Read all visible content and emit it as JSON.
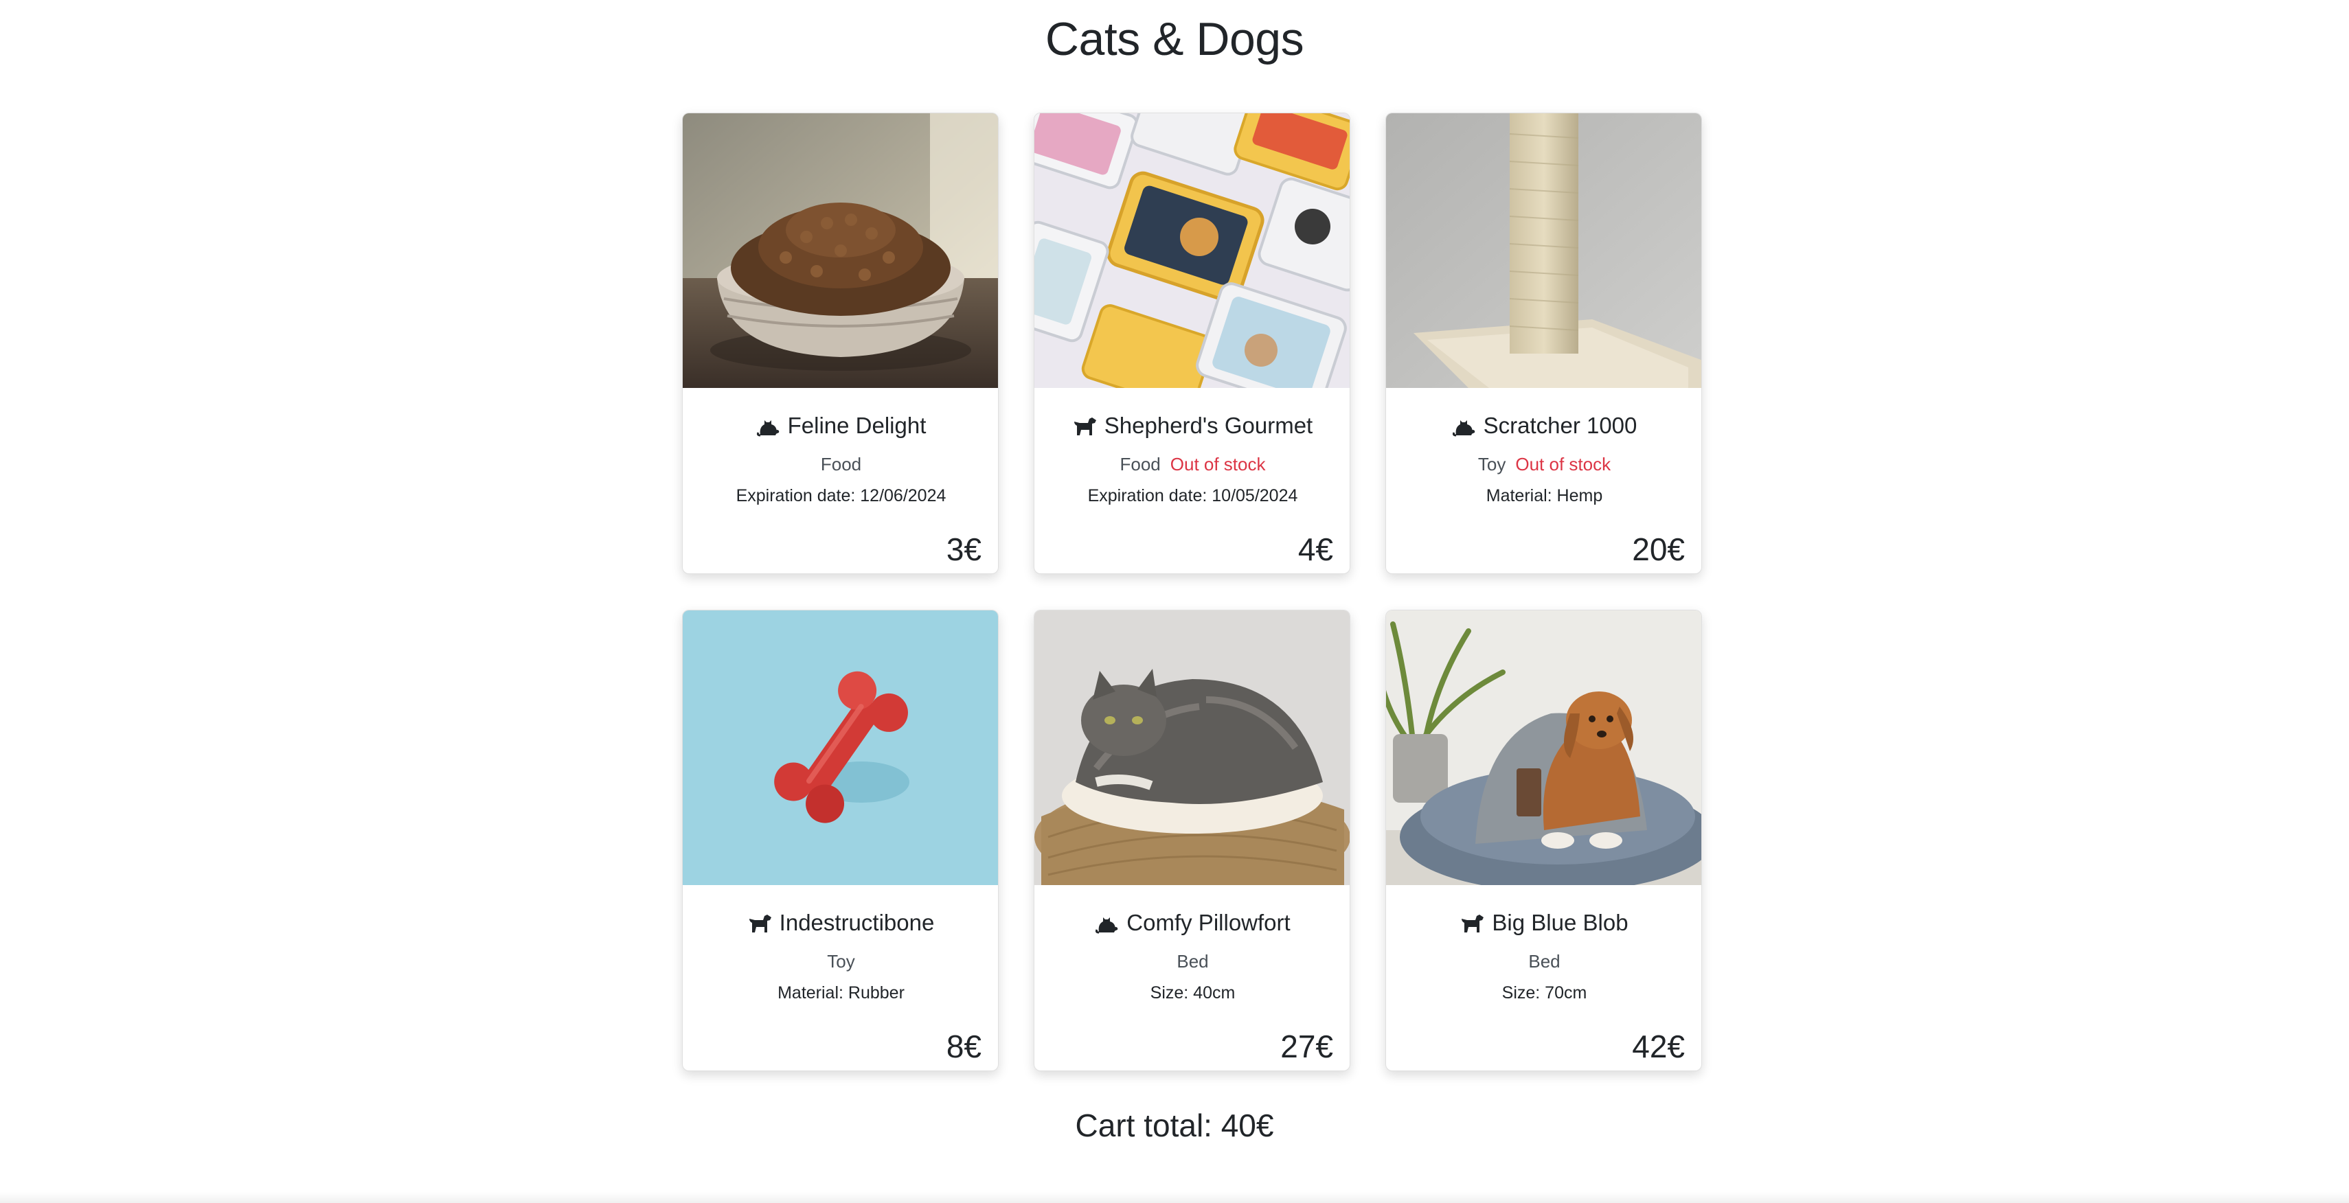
{
  "page": {
    "title": "Cats & Dogs"
  },
  "products": [
    {
      "name": "Feline Delight",
      "pet_icon": "cat-icon",
      "category": "Food",
      "stock_status": "",
      "detail": "Expiration date: 12/06/2024",
      "price": "3€",
      "image": "kibble-bowl-image"
    },
    {
      "name": "Shepherd's Gourmet",
      "pet_icon": "dog-icon",
      "category": "Food",
      "stock_status": "Out of stock",
      "detail": "Expiration date: 10/05/2024",
      "price": "4€",
      "image": "food-trays-image"
    },
    {
      "name": "Scratcher 1000",
      "pet_icon": "cat-icon",
      "category": "Toy",
      "stock_status": "Out of stock",
      "detail": "Material: Hemp",
      "price": "20€",
      "image": "scratching-post-image"
    },
    {
      "name": "Indestructibone",
      "pet_icon": "dog-icon",
      "category": "Toy",
      "stock_status": "",
      "detail": "Material: Rubber",
      "price": "8€",
      "image": "rubber-bone-image"
    },
    {
      "name": "Comfy Pillowfort",
      "pet_icon": "cat-icon",
      "category": "Bed",
      "stock_status": "",
      "detail": "Size: 40cm",
      "price": "27€",
      "image": "cat-basket-image"
    },
    {
      "name": "Big Blue Blob",
      "pet_icon": "dog-icon",
      "category": "Bed",
      "stock_status": "",
      "detail": "Size: 70cm",
      "price": "42€",
      "image": "dog-bed-image"
    }
  ],
  "cart": {
    "total_label": "Cart total: 40€"
  },
  "colors": {
    "text": "#212529",
    "muted": "#495057",
    "out_of_stock": "#dc3545"
  }
}
